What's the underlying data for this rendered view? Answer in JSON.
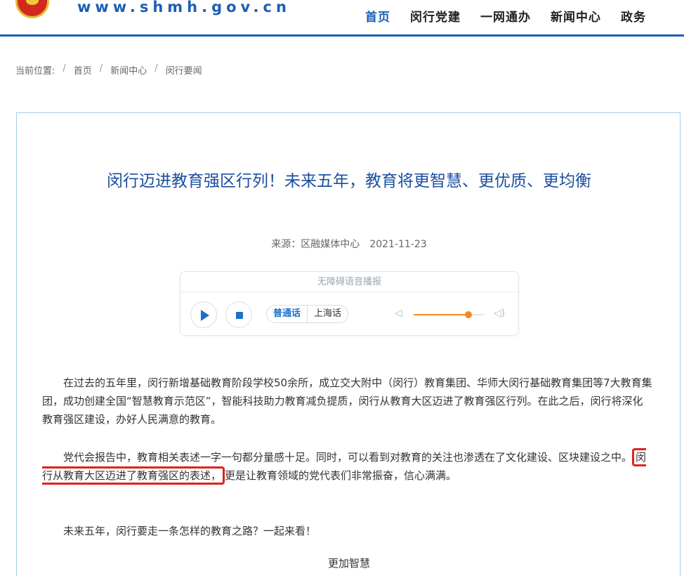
{
  "header": {
    "site_url": "www.shmh.gov.cn",
    "nav": [
      "首页",
      "闵行党建",
      "一网通办",
      "新闻中心",
      "政务"
    ]
  },
  "breadcrumb": {
    "label": "当前位置:",
    "items": [
      "首页",
      "新闻中心",
      "闵行要闻"
    ]
  },
  "article": {
    "title": "闵行迈进教育强区行列！未来五年，教育将更智慧、更优质、更均衡",
    "source": "来源：区融媒体中心",
    "date": "2021-11-23",
    "player": {
      "title": "无障碍语音播报",
      "lang_mandarin": "普通话",
      "lang_shanghai": "上海话",
      "volume_fraction": 0.78
    },
    "paragraphs": {
      "p1": "在过去的五年里，闵行新增基础教育阶段学校50余所，成立交大附中（闵行）教育集团、华师大闵行基础教育集团等7大教育集团，成功创建全国“智慧教育示范区”，智能科技助力教育减负提质，闵行从教育大区迈进了教育强区行列。在此之后，闵行将深化教育强区建设，办好人民满意的教育。",
      "p2_before": "党代会报告中，教育相关表述一字一句都分量感十足。同时，可以看到对教育的关注也渗透在了文化建设、区块建设之中。",
      "p2_highlight": "闵行从教育大区迈进了教育强区的表述，",
      "p2_after": "更是让教育领域的党代表们非常振奋，信心满满。",
      "p3": "未来五年，闵行要走一条怎样的教育之路？一起来看！"
    },
    "subheading": "更加智慧"
  }
}
